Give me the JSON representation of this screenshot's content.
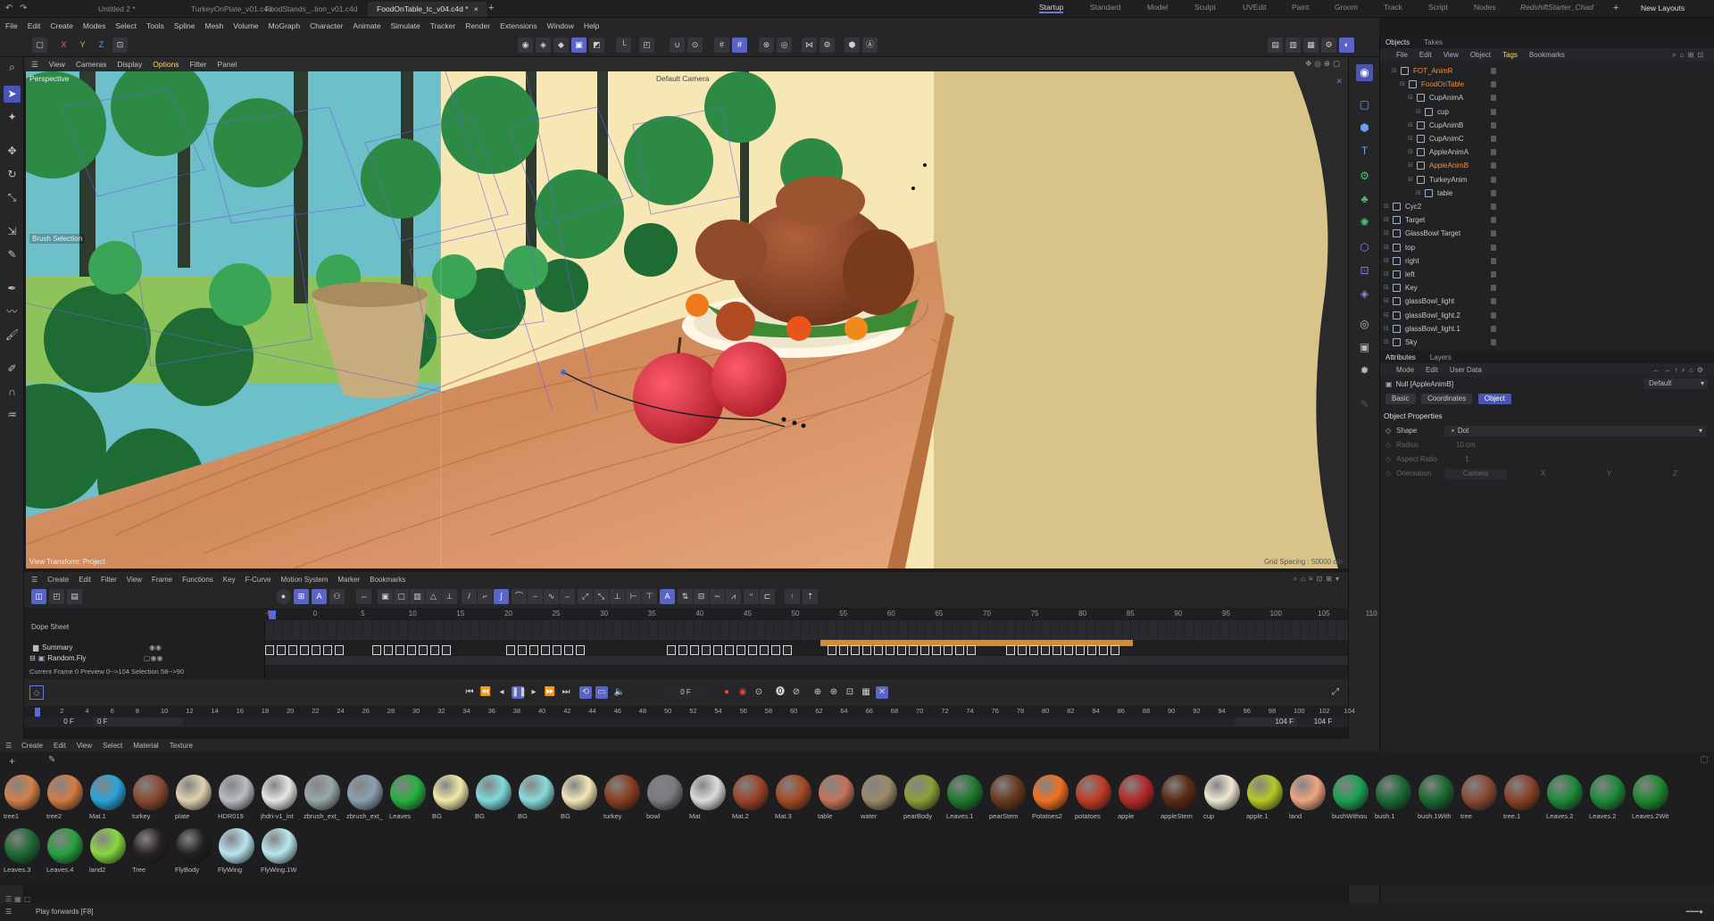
{
  "tabs": [
    {
      "label": "Untitled 2 *"
    },
    {
      "label": "TurkeyOnPlate_v01.c4d"
    },
    {
      "label": "FoodStands_..tion_v01.c4d"
    },
    {
      "label": "FoodOnTable_tc_v04.c4d *"
    }
  ],
  "layouts": [
    "Startup",
    "Standard",
    "Model",
    "Sculpt",
    "UVEdit",
    "Paint",
    "Groom",
    "Track",
    "Script",
    "Nodes",
    "RedshiftStarter_Chad"
  ],
  "new_layouts": "New Layouts",
  "menu": [
    "File",
    "Edit",
    "Create",
    "Modes",
    "Select",
    "Tools",
    "Spline",
    "Mesh",
    "Volume",
    "MoGraph",
    "Character",
    "Animate",
    "Simulate",
    "Tracker",
    "Render",
    "Extensions",
    "Window",
    "Help"
  ],
  "axis": {
    "x": "X",
    "y": "Y",
    "z": "Z"
  },
  "viewport": {
    "menu": [
      "View",
      "Cameras",
      "Display",
      "Options",
      "Filter",
      "Panel"
    ],
    "projection": "Perspective",
    "camera": "Default Camera",
    "brush": "Brush Selection",
    "transform": "View Transform: Project",
    "grid": "Grid Spacing : 50000 cm"
  },
  "objects": {
    "tabs": [
      "Objects",
      "Takes"
    ],
    "menu": [
      "File",
      "Edit",
      "View",
      "Object",
      "Tags",
      "Bookmarks"
    ],
    "rows": [
      {
        "name": "FOT_AnimR",
        "indent": 1,
        "hl": true
      },
      {
        "name": "FoodOnTable",
        "indent": 2,
        "hl": true
      },
      {
        "name": "CupAnimA",
        "indent": 3,
        "hl": false
      },
      {
        "name": "cup",
        "indent": 4,
        "hl": false
      },
      {
        "name": "CupAnimB",
        "indent": 3,
        "hl": false
      },
      {
        "name": "CupAnimC",
        "indent": 3,
        "hl": false
      },
      {
        "name": "AppleAnimA",
        "indent": 3,
        "hl": false
      },
      {
        "name": "AppleAnimB",
        "indent": 3,
        "hl": true
      },
      {
        "name": "TurkeyAnim",
        "indent": 3,
        "hl": false
      },
      {
        "name": "table",
        "indent": 4,
        "hl": false
      },
      {
        "name": "Cyc2",
        "indent": 0,
        "hl": false
      },
      {
        "name": "Target",
        "indent": 0,
        "hl": false
      },
      {
        "name": "GlassBowl Target",
        "indent": 0,
        "hl": false
      },
      {
        "name": "top",
        "indent": 0,
        "hl": false
      },
      {
        "name": "right",
        "indent": 0,
        "hl": false
      },
      {
        "name": "left",
        "indent": 0,
        "hl": false
      },
      {
        "name": "Key",
        "indent": 0,
        "hl": false
      },
      {
        "name": "glassBowl_light",
        "indent": 0,
        "hl": false
      },
      {
        "name": "glassBowl_light.2",
        "indent": 0,
        "hl": false
      },
      {
        "name": "glassBowl_light.1",
        "indent": 0,
        "hl": false
      },
      {
        "name": "Sky",
        "indent": 0,
        "hl": false
      }
    ]
  },
  "attributes": {
    "tabs": [
      "Attributes",
      "Layers"
    ],
    "menu": [
      "Mode",
      "Edit",
      "User Data"
    ],
    "object_name": "Null [AppleAnimB]",
    "preset": "Default",
    "buttons": [
      "Basic",
      "Coordinates",
      "Object"
    ],
    "section": "Object Properties",
    "props": [
      {
        "label": "Shape",
        "value": "Dot"
      },
      {
        "label": "Radius",
        "value": "10 cm"
      },
      {
        "label": "Aspect Ratio",
        "value": "1"
      },
      {
        "label": "Orientation",
        "value": "Camera"
      }
    ],
    "orient_axes": [
      "X",
      "Y",
      "Z"
    ]
  },
  "timeline": {
    "menu": [
      "Create",
      "Edit",
      "Filter",
      "View",
      "Frame",
      "Functions",
      "Key",
      "F-Curve",
      "Motion System",
      "Marker",
      "Bookmarks"
    ],
    "label": "Dope Sheet",
    "tracks": [
      "Summary",
      "Random.Fly"
    ],
    "info": "Current Frame  0  Preview  0-->104   Selection 58-->90",
    "ruler": [
      "-5",
      "0",
      "5",
      "10",
      "15",
      "20",
      "25",
      "30",
      "35",
      "40",
      "45",
      "50",
      "55",
      "60",
      "65",
      "70",
      "75",
      "80",
      "85",
      "90",
      "95",
      "100",
      "105",
      "110"
    ],
    "frame_field": "0 F",
    "start": "0 F",
    "start2": "0 F",
    "end": "104 F",
    "end2": "104 F",
    "frames": [
      "0",
      "2",
      "4",
      "6",
      "8",
      "10",
      "12",
      "14",
      "16",
      "18",
      "20",
      "22",
      "24",
      "26",
      "28",
      "30",
      "32",
      "34",
      "36",
      "38",
      "40",
      "42",
      "44",
      "46",
      "48",
      "50",
      "52",
      "54",
      "56",
      "58",
      "60",
      "62",
      "64",
      "66",
      "68",
      "70",
      "72",
      "74",
      "76",
      "78",
      "80",
      "82",
      "84",
      "86",
      "88",
      "90",
      "92",
      "94",
      "96",
      "98",
      "100",
      "102",
      "104"
    ]
  },
  "materials": {
    "menu": [
      "Create",
      "Edit",
      "View",
      "Select",
      "Material",
      "Texture"
    ],
    "items": [
      {
        "label": "tree1",
        "color": "#d2804a"
      },
      {
        "label": "tree2",
        "color": "#d27c44"
      },
      {
        "label": "Mat.1",
        "color": "#2aa4d8"
      },
      {
        "label": "turkey",
        "color": "#8a4a30"
      },
      {
        "label": "plate",
        "color": "#e0d2b0"
      },
      {
        "label": "HDR019",
        "color": "#b8bcc4"
      },
      {
        "label": "jhdri-v1_int",
        "color": "#e6e6e6"
      },
      {
        "label": "zbrush_ext_",
        "color": "#9aa8a8"
      },
      {
        "label": "zbrush_ext_",
        "color": "#8aa0b0"
      },
      {
        "label": "Leaves",
        "color": "#28b040"
      },
      {
        "label": "BG",
        "color": "#f2eaa8"
      },
      {
        "label": "BG",
        "color": "#80dada"
      },
      {
        "label": "BG",
        "color": "#8adcdc"
      },
      {
        "label": "BG",
        "color": "#f4e8b8"
      },
      {
        "label": "turkey",
        "color": "#8a3e20"
      },
      {
        "label": "bowl",
        "color": "#7a7a80"
      },
      {
        "label": "Mat",
        "color": "#dcdcdc"
      },
      {
        "label": "Mat.2",
        "color": "#9a4428"
      },
      {
        "label": "Mat.3",
        "color": "#a44a24"
      },
      {
        "label": "table",
        "color": "#c4745a"
      },
      {
        "label": "water",
        "color": "#9a8a68"
      },
      {
        "label": "pearBody",
        "color": "#8aa038"
      },
      {
        "label": "Leaves.1",
        "color": "#1f7a30"
      },
      {
        "label": "pearStem",
        "color": "#6a3a20"
      },
      {
        "label": "Potatoes2",
        "color": "#f07020"
      },
      {
        "label": "potatoes",
        "color": "#c03c24"
      },
      {
        "label": "apple",
        "color": "#b42a28"
      },
      {
        "label": "appleStem",
        "color": "#5a2a14"
      },
      {
        "label": "cup",
        "color": "#f0e8d4"
      },
      {
        "label": "apple.1",
        "color": "#b8c824"
      },
      {
        "label": "land",
        "color": "#f0a680"
      },
      {
        "label": "bushWithou",
        "color": "#1ea054"
      },
      {
        "label": "bush.1",
        "color": "#1a6a34"
      },
      {
        "label": "bush.1With",
        "color": "#1a6a30"
      },
      {
        "label": "tree",
        "color": "#8a4a34"
      },
      {
        "label": "tree.1",
        "color": "#8a4228"
      },
      {
        "label": "Leaves.2",
        "color": "#1e8a3a"
      },
      {
        "label": "Leaves.2",
        "color": "#1e8a3a"
      },
      {
        "label": "Leaves.2Wit",
        "color": "#1e8a30"
      },
      {
        "label": "Leaves.3",
        "color": "#1e6a34"
      },
      {
        "label": "Leaves.4",
        "color": "#28a040"
      },
      {
        "label": "land2",
        "color": "#88d840"
      },
      {
        "label": "Tree",
        "color": "#2a2226"
      },
      {
        "label": "FlyBody",
        "color": "#202020"
      },
      {
        "label": "FlyWing",
        "color": "#b8e4f0"
      },
      {
        "label": "FlyWing.1W",
        "color": "#b8e8f0"
      }
    ]
  },
  "status": "Play forwards [F8]"
}
